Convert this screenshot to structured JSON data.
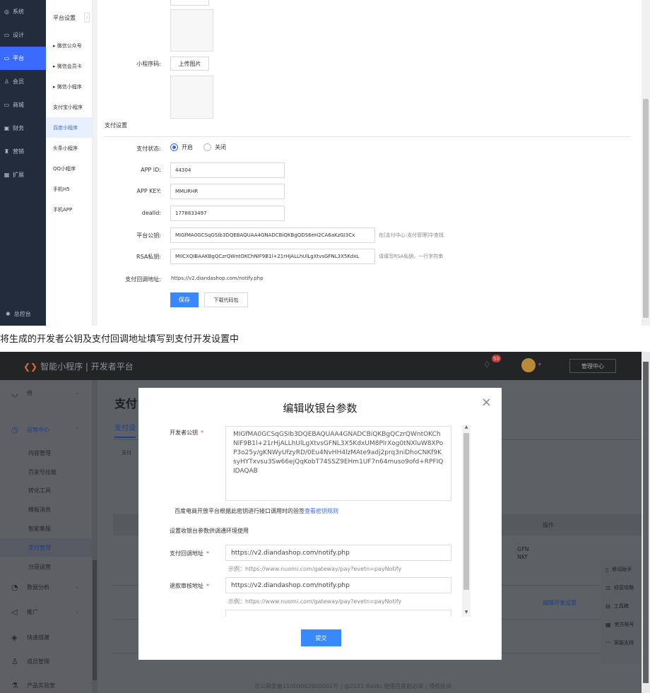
{
  "top": {
    "left_nav": [
      {
        "icon": "◎",
        "label": "系统"
      },
      {
        "icon": "▭",
        "label": "设计"
      },
      {
        "icon": "▭",
        "label": "平台"
      },
      {
        "icon": "♙",
        "label": "会员"
      },
      {
        "icon": "▭",
        "label": "商城"
      },
      {
        "icon": "▣",
        "label": "财务"
      },
      {
        "icon": "♜",
        "label": "营销"
      },
      {
        "icon": "▦",
        "label": "扩展"
      }
    ],
    "left_nav_bottom": "总控台",
    "sub_title": "平台设置",
    "sub_items": [
      "▸ 微信公众号",
      "▸ 微信会员卡",
      "▸ 微信小程序",
      "支付宝小程序",
      "百度小程序",
      "头条小程序",
      "QQ小程序",
      "手机H5",
      "手机APP"
    ],
    "upload_label": "小程序码:",
    "upload_btn": "上传图片",
    "section": "支付设置",
    "pay_status_label": "支付状态:",
    "radio_on": "开启",
    "radio_off": "关闭",
    "app_id_label": "APP ID:",
    "app_id": "44304",
    "app_key_label": "APP KEY:",
    "app_key": "MMURHR",
    "dealid_label": "dealId:",
    "dealid": "1778833497",
    "pubkey_label": "平台公钥:",
    "pubkey": "MIGfMA0GCSqGSIb3DQEBAQUAA4GNADCBiQKBgQDS6eH2CA6aKzGI3Cx",
    "pubkey_hint": "在[支付中心-支付管理]中查找",
    "rsa_label": "RSA私钥:",
    "rsa": "MIICXQIBAAKBgQCzrQWntOKChNIF9B1l+21rHjALLhUlLgXtvsGFNL3X5KdxL",
    "rsa_hint": "请填写RSA私钥，一行字符串",
    "callback_label": "支付回调地址:",
    "callback": "https://v2.diandashop.com/notify.php",
    "save": "保存",
    "download": "下载代码包"
  },
  "caption": "将生成的开发者公钥及支付回调地址填写到支付开发设置中",
  "bottom": {
    "brand": "智能小程序 | 开发者平台",
    "badge": "50",
    "manage": "管理中心",
    "menu": [
      {
        "icon": "◷",
        "label": "运营中心"
      },
      {
        "icon": "◔",
        "label": "数据分析"
      },
      {
        "icon": "◁",
        "label": "推广"
      },
      {
        "icon": "◈",
        "label": "快速搭建"
      },
      {
        "icon": "♙",
        "label": "成员管理"
      },
      {
        "icon": "⚗",
        "label": "产品实验室"
      }
    ],
    "sub_menu": [
      "内容管理",
      "百家号挂载",
      "转化工具",
      "模板消息",
      "智能客服",
      "支付管理",
      "分是运营"
    ],
    "top_blur": "络",
    "page_title": "支付",
    "tab": "支付设",
    "col_action": "操作",
    "cell_frag": "GFN\nNKf",
    "edit_link": "编辑开发设置",
    "tools": [
      "移动助手",
      "经营攻略",
      "工具箱",
      "官方账号",
      "客服支持"
    ],
    "footer": "京公网安备11000002000001号 | @2021 Baidu 使用百度前必读 | 侵权投诉"
  },
  "modal": {
    "title": "编辑收银台参数",
    "close": "×",
    "dev_key_label": "开发者公钥",
    "dev_key": "MIGfMA0GCSqGSIb3DQEBAQUAA4GNADCBiQKBgQCzrQWntOKChNlF9B1l+21rHjALLhUlLgXtvsGFNL3X5KdxUM8PlrXog0tNXluW8XPoP3o25y/gKNWyUfzyRD/0Eu4NvHH4lzMAte9adj2prq3niDhoCNKf9KsyHYTxvsu3Sw66ejQqKobT74SSZ9EHm1UF7n64muso9ofd+RPFIQIDAQAB",
    "dev_key_note": "百度电商开放平台根据此密钥进行接口调用时的验签",
    "dev_key_link": "查看密钥规则",
    "env_note": "设置收银台参数供调通环境使用",
    "callback_label": "支付回调地址",
    "callback": "https://v2.diandashop.com/notify.php",
    "callback_example": "示例：https://www.nuomi.com/gateway/pay?evetn=payNotify",
    "refund_label": "退款审核地址",
    "refund": "https://v2.diandashop.com/notify.php",
    "refund_example": "示例：https://www.nuomi.com/gateway/pay?evetn=payNotify",
    "submit": "提交"
  }
}
